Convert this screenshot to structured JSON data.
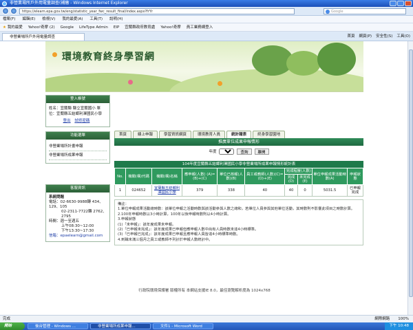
{
  "window": {
    "title": "非營業場所戶外用電量調查(補繳 - Windows Internet Explorer"
  },
  "address": {
    "url": "https://elearn.epa.gov.tw/eng/statistic_year_fwc_result_final/index.aspx?frYr",
    "search_placeholder": "Google"
  },
  "menu": [
    "檔案(F)",
    "編輯(E)",
    "檢視(V)",
    "我的最愛(A)",
    "工具(T)",
    "說明(H)"
  ],
  "favorites": [
    "我的最愛",
    "Yahoo!奇摩 (2)",
    "Google",
    "LifeType Admin",
    "EIP",
    "宜蘭縣政府教育處",
    "Yahoo!奇摩",
    "員工業務網登入"
  ],
  "tab": {
    "label": "非營業場所戶外用電量調查",
    "tools": [
      "首頁",
      "網頁(P)",
      "安全性(S)",
      "工具(O)"
    ]
  },
  "site": {
    "title": "環境教育終身學習網",
    "nav": [
      "首頁",
      "線上申報",
      "學習資訊網頁",
      "環境教育人員",
      "統計報表",
      "終身學習園地"
    ],
    "active_nav": 4
  },
  "login_box": {
    "heading": "登入帳號",
    "text": "姓名：宜蘭縣 縣立宜蘭國小 單位：宜蘭縣五結鄉利澤國民小學",
    "links": [
      "登出",
      "試修密碼"
    ]
  },
  "function_box": {
    "heading": "功能選單",
    "items": [
      "非營業場所計畫申報",
      "非營業場所成果申報"
    ]
  },
  "service_box": {
    "heading": "客服資訊",
    "lines": [
      "系統問題",
      "電話：02-6630-9988轉 434、129、105",
      "02-2311-7722轉 2762、2795",
      "時間：週一至週五",
      "上午08:30~12:00",
      "下午13:30~17:30",
      "信箱：epaelearn@gmail.com"
    ]
  },
  "report": {
    "section_title": "推廣單位成果申報情形",
    "year_label": "年度",
    "year_value": "104",
    "query_button": "查詢",
    "exit_button": "離開",
    "table_caption": "104年度宜蘭縣五結鄉利澤國民小學非營業場所成果申報情形統計表",
    "headers": [
      "No.",
      "機關(構)代碼",
      "機關(構)名稱",
      "應申報(人數) (A)=(B)+(C)",
      "單位已核報(人數)(B)",
      "員工或教師(人數)(C)=(D)+(E)",
      "完成(D)",
      "未完成(E)",
      "單位申報成果活動時數(A)",
      "申報狀態"
    ],
    "complete_group": "完成程度(人數)",
    "rows": [
      [
        "1",
        "024652",
        "宜蘭縣五結鄉利澤國民小學",
        "379",
        "338",
        "40",
        "40",
        "0",
        "5031.5",
        "已申報完成"
      ]
    ],
    "notes": [
      "備註：",
      "1.單位申報成果活動總時數：該單位申報之活動時數與該活動參與人數之總和，若單位人員參與其他單位活動，其時數則不影響此項目之時數計算。",
      "2.100年申報時數以3小時計算，100年以後申報時數則以4小時計算。",
      "3.申報狀態",
      "(1)「未申報」：該年度成果未申報。",
      "(2)「已申報未完成」：該年度成果已申報但應申報人數中尚有人員時數未達4小時標準。",
      "(3)「已申報已完成」：該年度成果已申報且應申報人員皆達4小時標準時數。",
      "4.到職未滿三個月之員工或教師不列計於申報人數統計中。"
    ]
  },
  "footer": "行政院環境保護署 版權所有 本網站支援IE 8.0，最佳瀏覽解析度為 1024x768",
  "statusbar": {
    "left": "完成",
    "zone": "網際網路",
    "zoom": "100%"
  },
  "taskbar": {
    "start": "開始",
    "tasks": [
      "後台管理 - Windows ...",
      "非營業場所成果申報...",
      "文件1 - Microsoft Word"
    ],
    "clock": "下午 10:48"
  }
}
